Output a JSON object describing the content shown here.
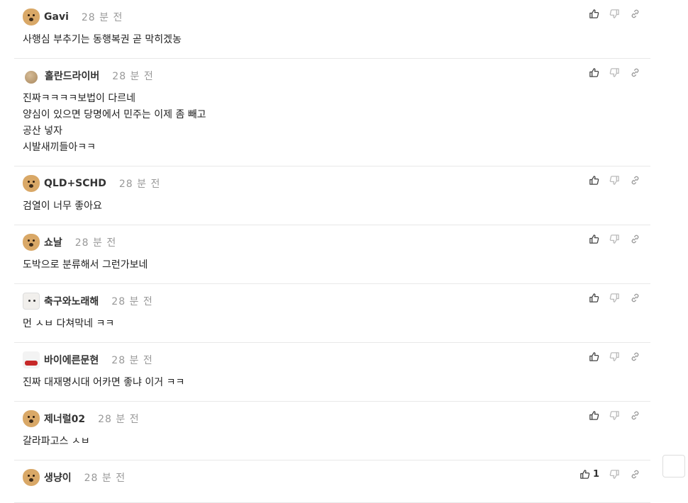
{
  "comments": [
    {
      "avatar": "dog-avatar",
      "name": "Gavi",
      "time": "28 분 전",
      "lines": [
        "사행심 부추기는 동행복권 곧 막히겠농"
      ],
      "likes": ""
    },
    {
      "avatar": "ball-avatar",
      "name": "홀란드라이버",
      "time": "28 분 전",
      "lines": [
        "진짜ㅋㅋㅋㅋ보법이 다르네",
        "양심이 있으면 당명에서 민주는 이제 좀 빼고",
        "공산 넣자",
        "시발새끼들아ㅋㅋ"
      ],
      "likes": ""
    },
    {
      "avatar": "dog-avatar",
      "name": "QLD+SCHD",
      "time": "28 분 전",
      "lines": [
        "검열이 너무 좋아요"
      ],
      "likes": ""
    },
    {
      "avatar": "dog-avatar",
      "name": "쇼날",
      "time": "28 분 전",
      "lines": [
        "도박으로 분류해서 그런가보네"
      ],
      "likes": ""
    },
    {
      "avatar": "white-avatar",
      "name": "축구와노래해",
      "time": "28 분 전",
      "lines": [
        "먼 ㅅㅂ 다쳐막네 ㅋㅋ"
      ],
      "likes": ""
    },
    {
      "avatar": "red-avatar",
      "name": "바이에른문현",
      "time": "28 분 전",
      "lines": [
        "진짜 대재명시대 어카면 좋냐 이거 ㅋㅋ"
      ],
      "likes": ""
    },
    {
      "avatar": "dog-avatar",
      "name": "제너럴02",
      "time": "28 분 전",
      "lines": [
        "갈라파고스 ㅅㅂ"
      ],
      "likes": ""
    },
    {
      "avatar": "dog-avatar",
      "name": "생냥이",
      "time": "28 분 전",
      "lines": [
        ""
      ],
      "likes": "1"
    }
  ],
  "colors": {
    "like": "#444",
    "dislike": "#bbb",
    "link": "#999"
  }
}
